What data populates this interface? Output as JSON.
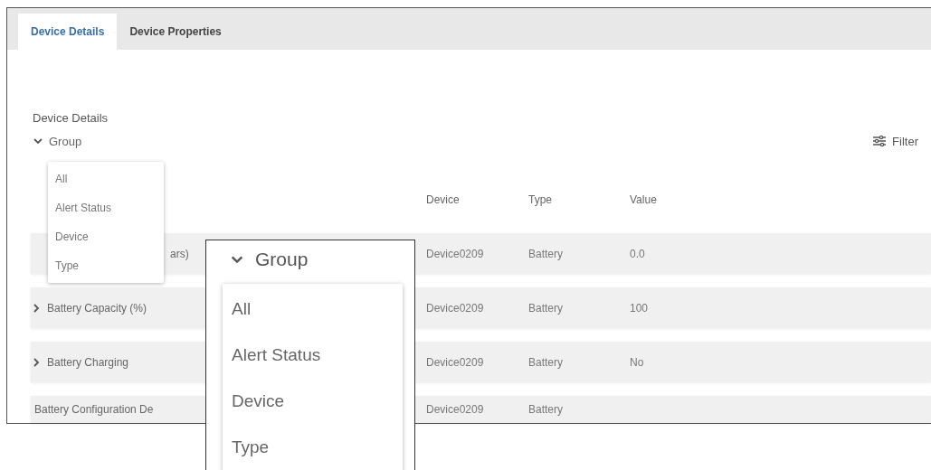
{
  "tabs": [
    {
      "label": "Device Details",
      "selected": true
    },
    {
      "label": "Device Properties",
      "selected": false
    }
  ],
  "section_title": "Device Details",
  "group_toggle": {
    "label": "Group",
    "expanded": true
  },
  "group_menu": {
    "items": [
      "All",
      "Alert Status",
      "Device",
      "Type"
    ]
  },
  "filter": {
    "label": "Filter"
  },
  "table": {
    "columns": [
      "Device",
      "Type",
      "Value"
    ],
    "rows": [
      {
        "kind": "covered",
        "name": "ars)",
        "device": "Device0209",
        "type": "Battery",
        "value": "0.0"
      },
      {
        "kind": "expandable",
        "name": "Battery Capacity (%)",
        "device": "Device0209",
        "type": "Battery",
        "value": "100"
      },
      {
        "kind": "expandable",
        "name": "Battery Charging",
        "device": "Device0209",
        "type": "Battery",
        "value": "No"
      },
      {
        "kind": "plain",
        "name": "Battery Configuration De",
        "device": "Device0209",
        "type": "Battery"
      }
    ]
  },
  "callout": {
    "group_toggle": {
      "label": "Group",
      "expanded": true
    },
    "items": [
      "All",
      "Alert Status",
      "Device",
      "Type"
    ]
  }
}
